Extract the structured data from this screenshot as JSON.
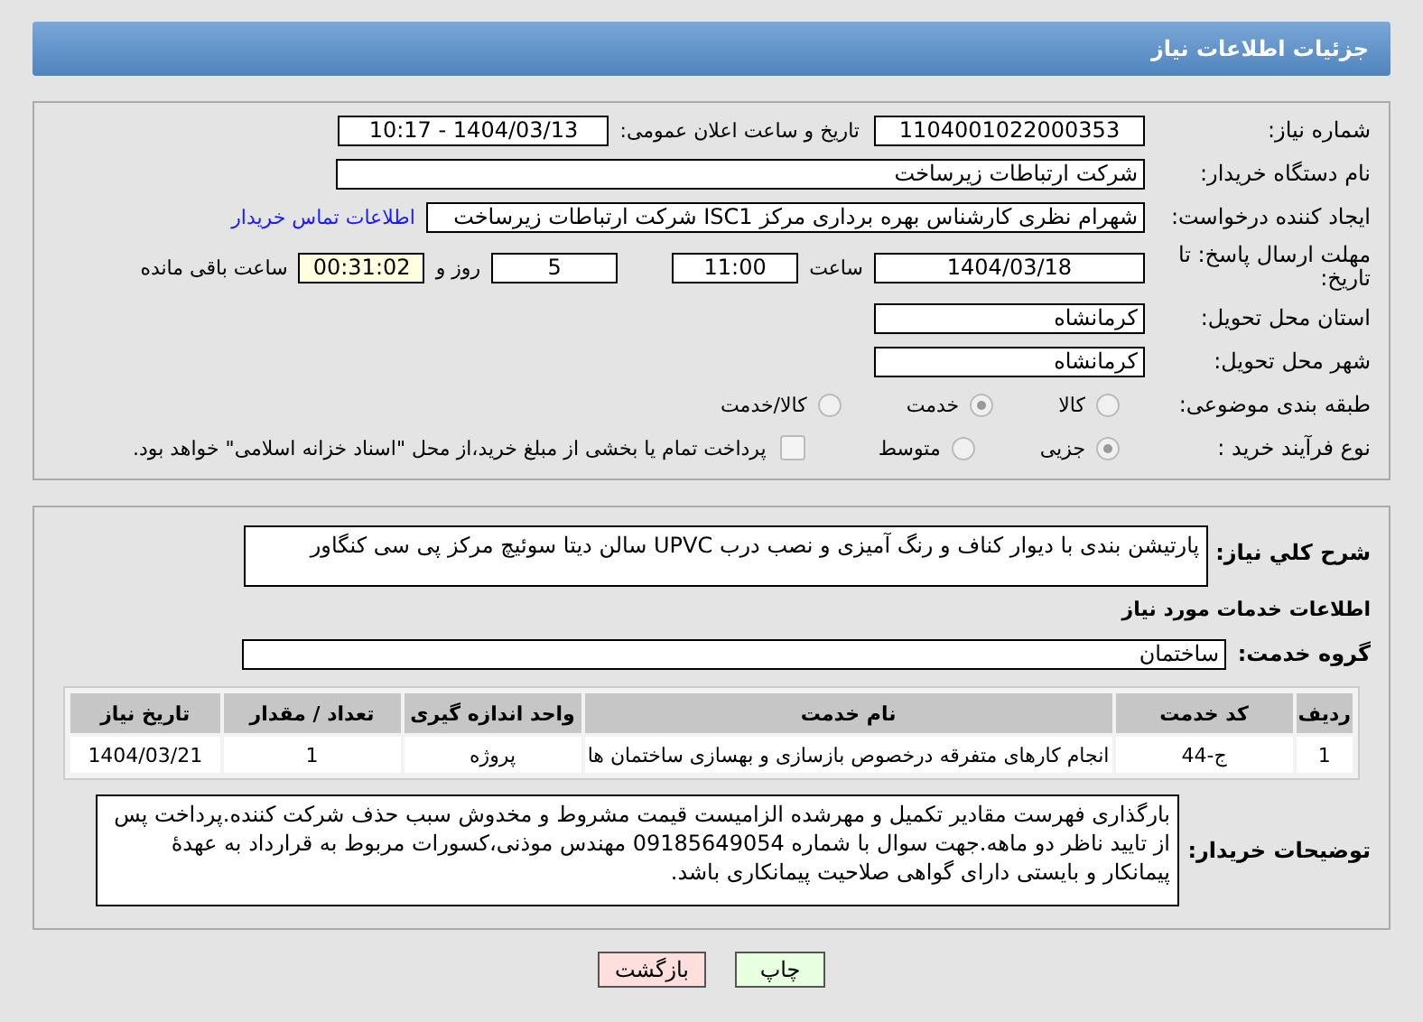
{
  "header": {
    "title": "جزئیات اطلاعات نیاز"
  },
  "details": {
    "need_number": {
      "label": "شماره نیاز:",
      "value": "1104001022000353"
    },
    "announce_date": {
      "label": "تاریخ و ساعت اعلان عمومی:",
      "value": "1404/03/13 - 10:17"
    },
    "buyer_org": {
      "label": "نام دستگاه خریدار:",
      "value": "شرکت ارتباطات زیرساخت"
    },
    "requester": {
      "label": "ایجاد کننده درخواست:",
      "value": "شهرام نظری کارشناس بهره برداری مرکز ISC1 شرکت ارتباطات زیرساخت",
      "link": "اطلاعات تماس خریدار"
    },
    "deadline": {
      "label": "مهلت ارسال پاسخ: تا تاریخ:",
      "date": "1404/03/18",
      "time_label": "ساعت",
      "time": "11:00",
      "days": "5",
      "days_label": "روز و",
      "remaining": "00:31:02",
      "remaining_label": "ساعت باقی مانده"
    },
    "province": {
      "label": "استان محل تحویل:",
      "value": "کرمانشاه"
    },
    "city": {
      "label": "شهر محل تحویل:",
      "value": "کرمانشاه"
    },
    "category": {
      "label": "طبقه بندی موضوعی:",
      "options": [
        {
          "label": "کالا",
          "selected": false
        },
        {
          "label": "خدمت",
          "selected": true
        },
        {
          "label": "کالا/خدمت",
          "selected": false
        }
      ]
    },
    "process": {
      "label": "نوع فرآیند خرید :",
      "options": [
        {
          "label": "جزیی",
          "selected": true
        },
        {
          "label": "متوسط",
          "selected": false
        }
      ],
      "payment": {
        "label": "پرداخت تمام یا بخشی از مبلغ خرید،از محل \"اسناد خزانه اسلامی\" خواهد بود.",
        "checked": false
      }
    }
  },
  "description": {
    "label": "شرح کلي نياز:",
    "value": "پارتیشن بندی با دیوار کناف و رنگ آمیزی و نصب درب UPVC سالن دیتا سوئیچ مرکز پی سی کنگاور"
  },
  "services": {
    "title": "اطلاعات خدمات مورد نیاز",
    "group_label": "گروه خدمت:",
    "group_value": "ساختمان",
    "table": {
      "columns": [
        "ردیف",
        "کد خدمت",
        "نام خدمت",
        "واحد اندازه گیری",
        "تعداد / مقدار",
        "تاریخ نیاز"
      ],
      "rows": [
        [
          "1",
          "ج-44",
          "انجام کارهای متفرقه درخصوص بازسازی و بهسازی ساختمان ها",
          "پروژه",
          "1",
          "1404/03/21"
        ]
      ]
    }
  },
  "buyer_notes": {
    "label": "توضیحات خریدار:",
    "value": "بارگذاری فهرست مقادیر تکمیل و مهرشده الزامیست قیمت مشروط و مخدوش سبب حذف شرکت کننده.پرداخت پس از تایید ناظر دو ماهه.جهت  سوال با شماره 09185649054 مهندس موذنی،کسورات مربوط به قرارداد به عهدهٔ پیمانکار و بایستی دارای گواهی صلاحیت پیمانکاری باشد."
  },
  "buttons": [
    {
      "label": "چاپ",
      "kind": "print"
    },
    {
      "label": "بازگشت",
      "kind": "back"
    }
  ]
}
